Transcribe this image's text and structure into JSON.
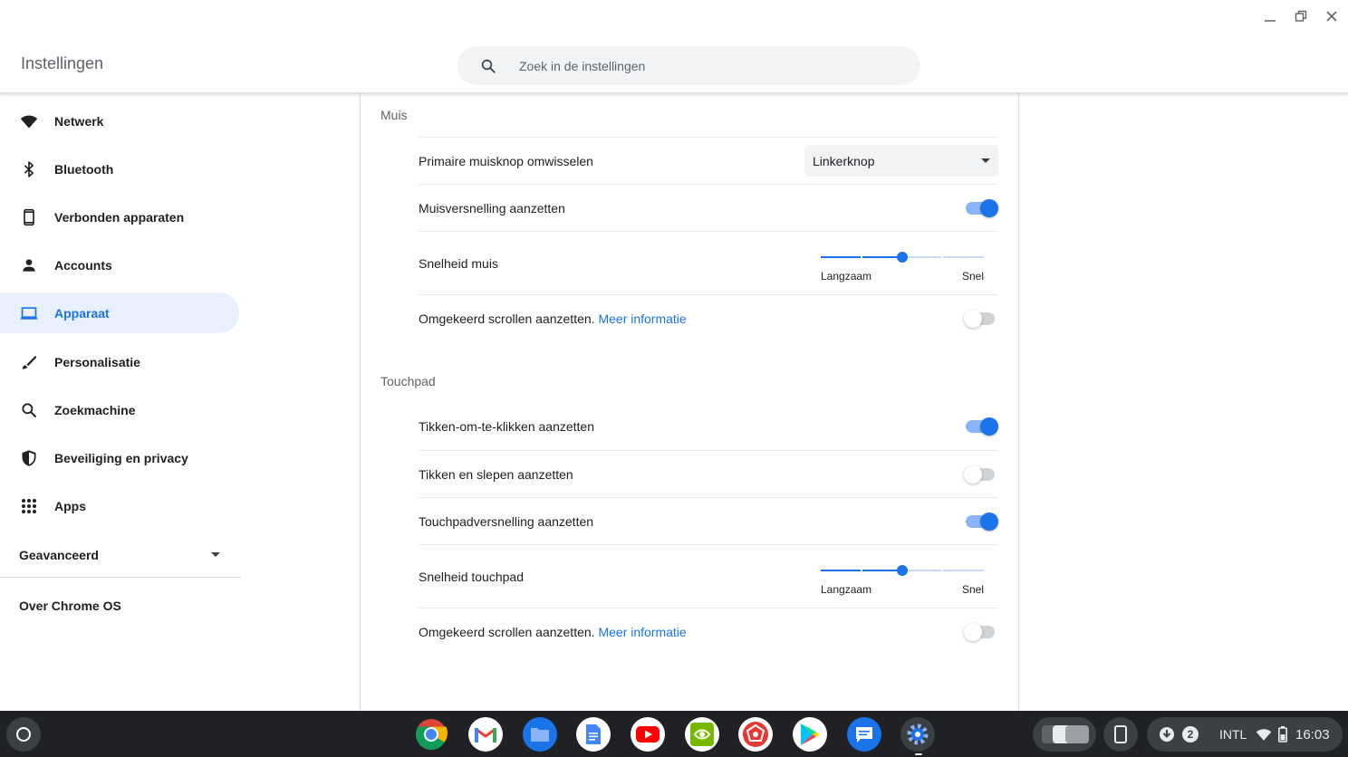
{
  "header": {
    "title": "Instellingen",
    "search_placeholder": "Zoek in de instellingen"
  },
  "sidebar": {
    "items": [
      {
        "label": "Netwerk",
        "icon": "wifi-icon"
      },
      {
        "label": "Bluetooth",
        "icon": "bluetooth-icon"
      },
      {
        "label": "Verbonden apparaten",
        "icon": "phone-icon"
      },
      {
        "label": "Accounts",
        "icon": "person-icon"
      },
      {
        "label": "Apparaat",
        "icon": "laptop-icon",
        "active": true
      },
      {
        "label": "Personalisatie",
        "icon": "brush-icon"
      },
      {
        "label": "Zoekmachine",
        "icon": "search-icon"
      },
      {
        "label": "Beveiliging en privacy",
        "icon": "shield-icon"
      },
      {
        "label": "Apps",
        "icon": "apps-grid-icon"
      }
    ],
    "advanced_label": "Geavanceerd",
    "about_label": "Over Chrome OS"
  },
  "mouse": {
    "section_title": "Muis",
    "swap_label": "Primaire muisknop omwisselen",
    "swap_value": "Linkerknop",
    "accel_label": "Muisversnelling aanzetten",
    "accel_on": true,
    "speed_label": "Snelheid muis",
    "speed_level": 0.5,
    "speed_min": "Langzaam",
    "speed_max": "Snel",
    "reverse_label": "Omgekeerd scrollen aanzetten.",
    "reverse_link": "Meer informatie",
    "reverse_on": false
  },
  "touchpad": {
    "section_title": "Touchpad",
    "tap_click_label": "Tikken-om-te-klikken aanzetten",
    "tap_click_on": true,
    "tap_drag_label": "Tikken en slepen aanzetten",
    "tap_drag_on": false,
    "accel_label": "Touchpadversnelling aanzetten",
    "accel_on": true,
    "speed_label": "Snelheid touchpad",
    "speed_level": 0.5,
    "speed_min": "Langzaam",
    "speed_max": "Snel",
    "reverse_label": "Omgekeerd scrollen aanzetten.",
    "reverse_link": "Meer informatie",
    "reverse_on": false
  },
  "shelf": {
    "apps": [
      "chrome-icon",
      "gmail-icon",
      "files-icon",
      "docs-icon",
      "youtube-icon",
      "nvidia-icon",
      "app-red-icon",
      "play-store-icon",
      "messages-icon",
      "settings-icon"
    ],
    "notification_count": "2",
    "ime": "INTL",
    "time": "16:03"
  },
  "colors": {
    "accent": "#1a73e8",
    "active_bg": "#e8f0fe",
    "shelf_bg": "#202124"
  }
}
